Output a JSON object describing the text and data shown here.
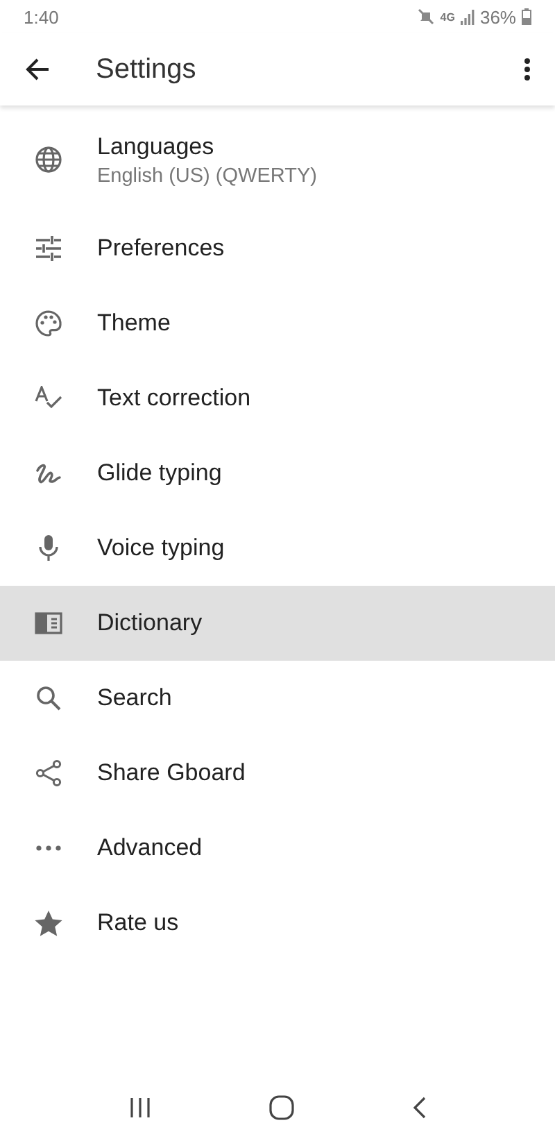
{
  "status_bar": {
    "time": "1:40",
    "network": "4G",
    "battery_text": "36%"
  },
  "toolbar": {
    "title": "Settings"
  },
  "items": [
    {
      "title": "Languages",
      "subtitle": "English (US) (QWERTY)",
      "selected": false
    },
    {
      "title": "Preferences",
      "selected": false
    },
    {
      "title": "Theme",
      "selected": false
    },
    {
      "title": "Text correction",
      "selected": false
    },
    {
      "title": "Glide typing",
      "selected": false
    },
    {
      "title": "Voice typing",
      "selected": false
    },
    {
      "title": "Dictionary",
      "selected": true
    },
    {
      "title": "Search",
      "selected": false
    },
    {
      "title": "Share Gboard",
      "selected": false
    },
    {
      "title": "Advanced",
      "selected": false
    },
    {
      "title": "Rate us",
      "selected": false
    }
  ]
}
